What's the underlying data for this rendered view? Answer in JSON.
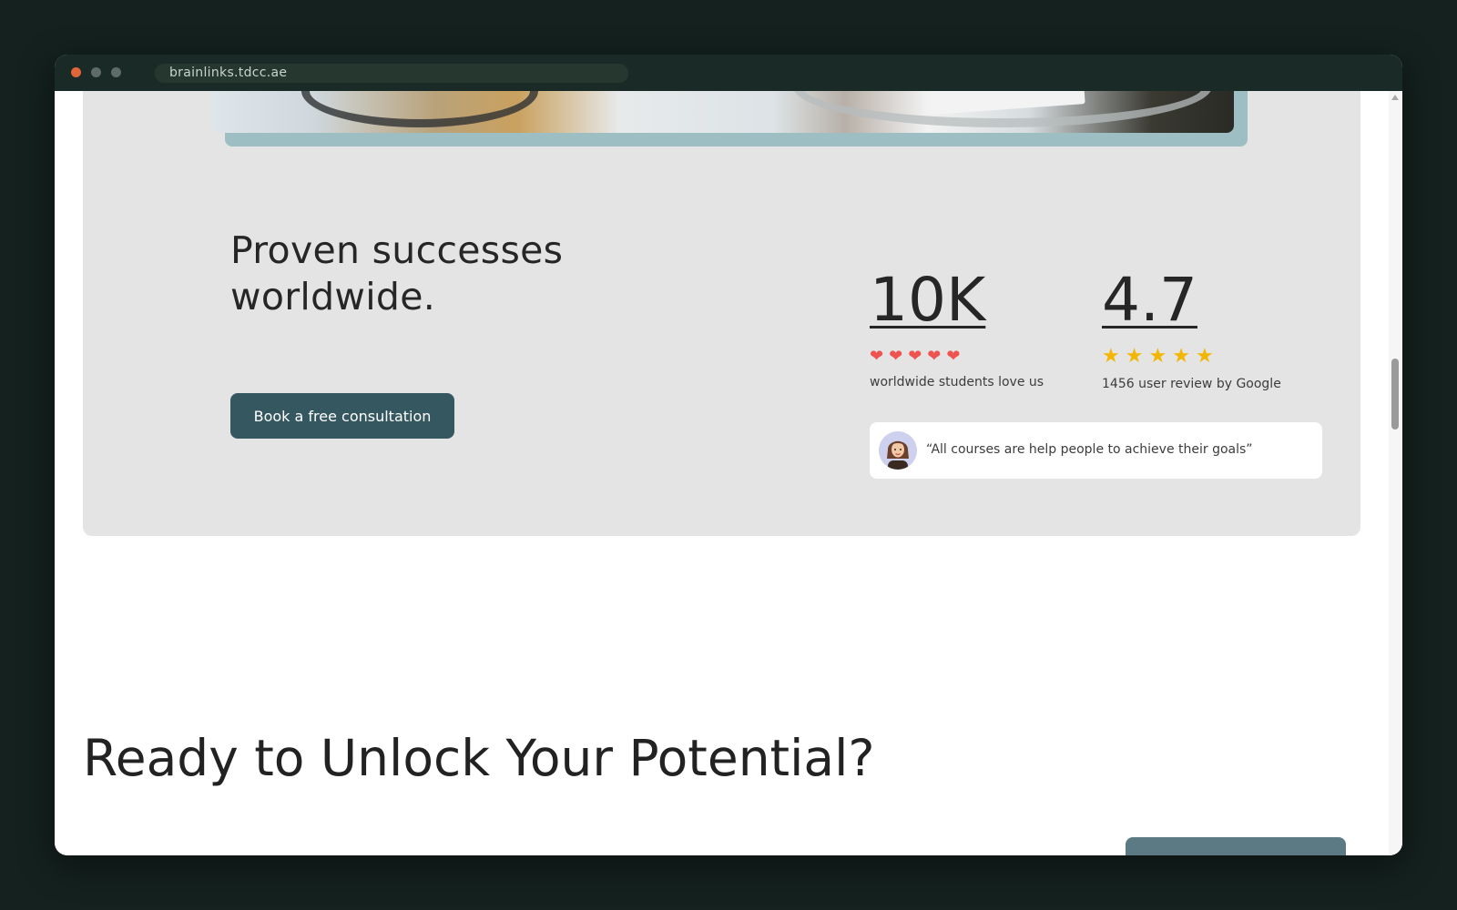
{
  "browser": {
    "url": "brainlinks.tdcc.ae"
  },
  "hero": {
    "heading": "Proven successes worldwide.",
    "cta_label": "Book a free consultation"
  },
  "stats": {
    "students": {
      "value": "10K",
      "caption": "worldwide students love us",
      "hearts": 5
    },
    "rating": {
      "value": "4.7",
      "caption": "1456 user review by Google",
      "stars": 5
    }
  },
  "review": {
    "quote": "“All courses are help people to achieve their goals”"
  },
  "cta_section": {
    "heading": "Ready to Unlock Your Potential?"
  },
  "icons": {
    "heart": "heart-icon",
    "star": "star-icon"
  },
  "colors": {
    "primary_button": "#355760",
    "heart": "#ef5350",
    "star": "#f2b705",
    "section_bg": "#e4e4e4"
  }
}
